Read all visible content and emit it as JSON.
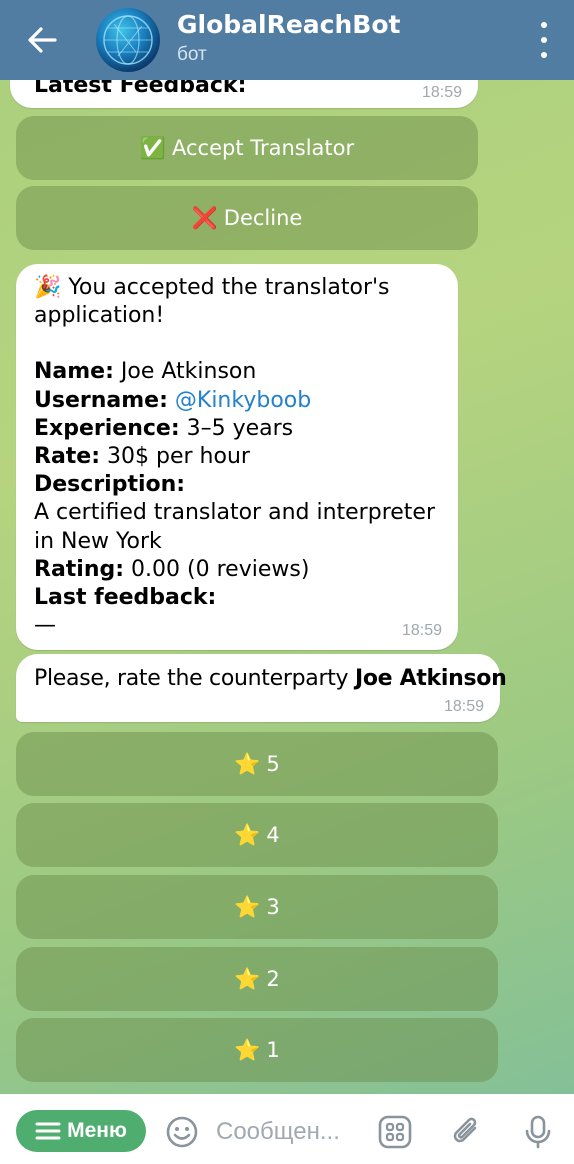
{
  "header": {
    "title": "GlobalReachBot",
    "subtitle": "бот"
  },
  "top_message": {
    "partial_text": "Latest Feedback:",
    "time": "18:59"
  },
  "action_buttons": [
    {
      "emoji": "✅",
      "label": "Accept Translator"
    },
    {
      "emoji": "❌",
      "label": "Decline"
    }
  ],
  "accept_message": {
    "emoji": "🎉",
    "intro": "You accepted the translator's application!",
    "fields": {
      "name_label": "Name:",
      "name_value": " Joe Atkinson",
      "username_label": "Username:",
      "username_value": "@Kinkyboob",
      "experience_label": "Experience:",
      "experience_value": " 3–5 years",
      "rate_label": "Rate:",
      "rate_value": " 30$ per hour",
      "description_label": "Description:",
      "description_value": "A certified translator and interpreter in New York",
      "rating_label": "Rating:",
      "rating_value": " 0.00 (0 reviews)",
      "feedback_label": "Last feedback:",
      "feedback_value": "—"
    },
    "time": "18:59"
  },
  "rate_message": {
    "text": "Please, rate the counterparty ",
    "name": "Joe Atkinson",
    "time": "18:59"
  },
  "rating_buttons": [
    {
      "emoji": "⭐",
      "label": "5"
    },
    {
      "emoji": "⭐",
      "label": "4"
    },
    {
      "emoji": "⭐",
      "label": "3"
    },
    {
      "emoji": "⭐",
      "label": "2"
    },
    {
      "emoji": "⭐",
      "label": "1"
    }
  ],
  "input_bar": {
    "menu_label": "Меню",
    "placeholder": "Сообщен..."
  },
  "icons": {
    "back": "arrow-left-icon",
    "more": "kebab-icon",
    "emoji": "smiley-icon",
    "commands": "grid-icon",
    "attach": "paperclip-icon",
    "mic": "microphone-icon"
  },
  "colors": {
    "header": "#517da2",
    "menu_button": "#4fae6f",
    "link": "#2481cc"
  }
}
